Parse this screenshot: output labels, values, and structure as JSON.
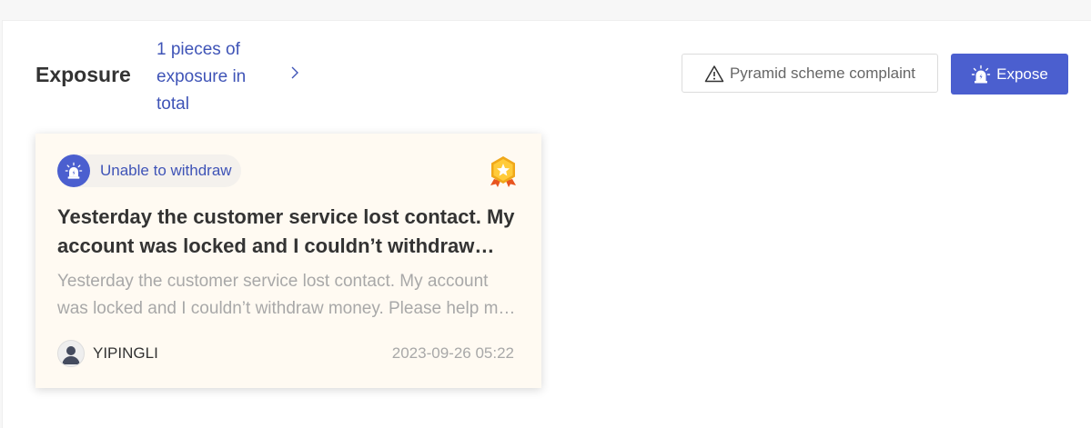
{
  "section": {
    "title": "Exposure",
    "count_link": "1 pieces of exposure in total",
    "complaint_button": "Pyramid scheme complaint",
    "expose_button": "Expose"
  },
  "cards": [
    {
      "tag": "Unable to withdraw",
      "title": "Yesterday the customer service lost contact. My account was locked and I couldn’t withdraw money.",
      "description": "Yesterday the customer service lost contact. My account was locked and I couldn’t withdraw money. Please help me get my money back.",
      "author": "YIPINGLI",
      "date": "2023-09-26 05:22"
    }
  ],
  "colors": {
    "accent": "#4b5fcf",
    "link": "#3f54b7",
    "card_bg": "#fffaf2",
    "medal": "#f5b820"
  },
  "icons": {
    "warning": "warning-triangle-icon",
    "expose": "alarm-siren-icon",
    "medal": "gold-medal-icon",
    "chevron": "chevron-right-icon",
    "avatar": "user-avatar-icon"
  }
}
